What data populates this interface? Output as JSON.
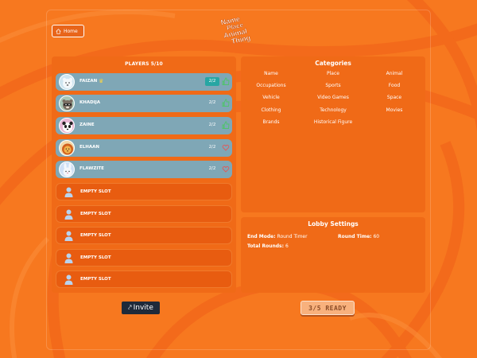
{
  "header": {
    "home_label": "Home",
    "logo": {
      "lines": [
        "Name",
        "Place",
        "Animal",
        "Thing"
      ],
      "connectors": [
        "•",
        "&",
        "&"
      ]
    }
  },
  "players": {
    "title": "PLAYERS 5/10",
    "list": [
      {
        "name": "FAIZAN",
        "score": "2/2",
        "host": true,
        "avatar": "bear-icon",
        "liked": true
      },
      {
        "name": "KHADIJA",
        "score": "2/2",
        "host": false,
        "avatar": "raccoon-icon",
        "liked": true
      },
      {
        "name": "ZAINE",
        "score": "2/2",
        "host": false,
        "avatar": "panda-icon",
        "liked": true
      },
      {
        "name": "ELHAAN",
        "score": "2/2",
        "host": false,
        "avatar": "lion-icon",
        "liked": false
      },
      {
        "name": "FLAWZITE",
        "score": "2/2",
        "host": false,
        "avatar": "bunny-icon",
        "liked": false
      }
    ],
    "empty_slot_label": "EMPTY SLOT",
    "empty_slots": 5
  },
  "categories": {
    "title": "Categories",
    "items": [
      "Name",
      "Place",
      "Animal",
      "Occupations",
      "Sports",
      "Food",
      "Vehicle",
      "Video Games",
      "Space",
      "Clothing",
      "Technology",
      "Movies",
      "Brands",
      "Historical Figure"
    ]
  },
  "lobby": {
    "title": "Lobby Settings",
    "end_mode_label": "End Mode:",
    "end_mode_value": "Round Timer",
    "round_time_label": "Round Time:",
    "round_time_value": "60",
    "total_rounds_label": "Total Rounds:",
    "total_rounds_value": "6"
  },
  "actions": {
    "invite_label": "Invite",
    "ready_label": "3/5 READY"
  },
  "colors": {
    "background": "#f7781f",
    "panel": "#f06a17",
    "player_row": "#7fa7b6",
    "empty_row": "#e85c10",
    "invite_button": "#1f2a3a",
    "ready_button": "#f8b17d",
    "score_highlight": "#27a6a3"
  }
}
